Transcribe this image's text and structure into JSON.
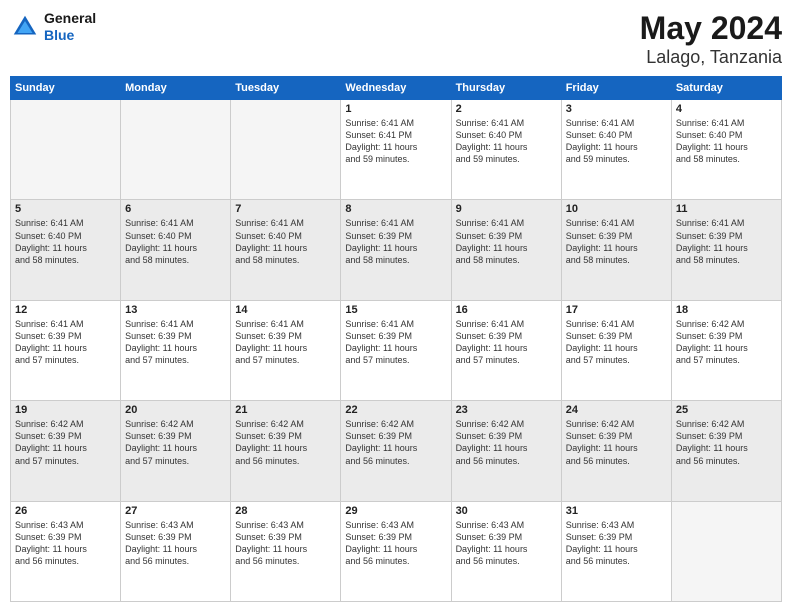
{
  "header": {
    "logo_general": "General",
    "logo_blue": "Blue",
    "month_year": "May 2024",
    "location": "Lalago, Tanzania"
  },
  "weekdays": [
    "Sunday",
    "Monday",
    "Tuesday",
    "Wednesday",
    "Thursday",
    "Friday",
    "Saturday"
  ],
  "weeks": [
    [
      {
        "day": "",
        "info": ""
      },
      {
        "day": "",
        "info": ""
      },
      {
        "day": "",
        "info": ""
      },
      {
        "day": "1",
        "info": "Sunrise: 6:41 AM\nSunset: 6:41 PM\nDaylight: 11 hours\nand 59 minutes."
      },
      {
        "day": "2",
        "info": "Sunrise: 6:41 AM\nSunset: 6:40 PM\nDaylight: 11 hours\nand 59 minutes."
      },
      {
        "day": "3",
        "info": "Sunrise: 6:41 AM\nSunset: 6:40 PM\nDaylight: 11 hours\nand 59 minutes."
      },
      {
        "day": "4",
        "info": "Sunrise: 6:41 AM\nSunset: 6:40 PM\nDaylight: 11 hours\nand 58 minutes."
      }
    ],
    [
      {
        "day": "5",
        "info": "Sunrise: 6:41 AM\nSunset: 6:40 PM\nDaylight: 11 hours\nand 58 minutes."
      },
      {
        "day": "6",
        "info": "Sunrise: 6:41 AM\nSunset: 6:40 PM\nDaylight: 11 hours\nand 58 minutes."
      },
      {
        "day": "7",
        "info": "Sunrise: 6:41 AM\nSunset: 6:40 PM\nDaylight: 11 hours\nand 58 minutes."
      },
      {
        "day": "8",
        "info": "Sunrise: 6:41 AM\nSunset: 6:39 PM\nDaylight: 11 hours\nand 58 minutes."
      },
      {
        "day": "9",
        "info": "Sunrise: 6:41 AM\nSunset: 6:39 PM\nDaylight: 11 hours\nand 58 minutes."
      },
      {
        "day": "10",
        "info": "Sunrise: 6:41 AM\nSunset: 6:39 PM\nDaylight: 11 hours\nand 58 minutes."
      },
      {
        "day": "11",
        "info": "Sunrise: 6:41 AM\nSunset: 6:39 PM\nDaylight: 11 hours\nand 58 minutes."
      }
    ],
    [
      {
        "day": "12",
        "info": "Sunrise: 6:41 AM\nSunset: 6:39 PM\nDaylight: 11 hours\nand 57 minutes."
      },
      {
        "day": "13",
        "info": "Sunrise: 6:41 AM\nSunset: 6:39 PM\nDaylight: 11 hours\nand 57 minutes."
      },
      {
        "day": "14",
        "info": "Sunrise: 6:41 AM\nSunset: 6:39 PM\nDaylight: 11 hours\nand 57 minutes."
      },
      {
        "day": "15",
        "info": "Sunrise: 6:41 AM\nSunset: 6:39 PM\nDaylight: 11 hours\nand 57 minutes."
      },
      {
        "day": "16",
        "info": "Sunrise: 6:41 AM\nSunset: 6:39 PM\nDaylight: 11 hours\nand 57 minutes."
      },
      {
        "day": "17",
        "info": "Sunrise: 6:41 AM\nSunset: 6:39 PM\nDaylight: 11 hours\nand 57 minutes."
      },
      {
        "day": "18",
        "info": "Sunrise: 6:42 AM\nSunset: 6:39 PM\nDaylight: 11 hours\nand 57 minutes."
      }
    ],
    [
      {
        "day": "19",
        "info": "Sunrise: 6:42 AM\nSunset: 6:39 PM\nDaylight: 11 hours\nand 57 minutes."
      },
      {
        "day": "20",
        "info": "Sunrise: 6:42 AM\nSunset: 6:39 PM\nDaylight: 11 hours\nand 57 minutes."
      },
      {
        "day": "21",
        "info": "Sunrise: 6:42 AM\nSunset: 6:39 PM\nDaylight: 11 hours\nand 56 minutes."
      },
      {
        "day": "22",
        "info": "Sunrise: 6:42 AM\nSunset: 6:39 PM\nDaylight: 11 hours\nand 56 minutes."
      },
      {
        "day": "23",
        "info": "Sunrise: 6:42 AM\nSunset: 6:39 PM\nDaylight: 11 hours\nand 56 minutes."
      },
      {
        "day": "24",
        "info": "Sunrise: 6:42 AM\nSunset: 6:39 PM\nDaylight: 11 hours\nand 56 minutes."
      },
      {
        "day": "25",
        "info": "Sunrise: 6:42 AM\nSunset: 6:39 PM\nDaylight: 11 hours\nand 56 minutes."
      }
    ],
    [
      {
        "day": "26",
        "info": "Sunrise: 6:43 AM\nSunset: 6:39 PM\nDaylight: 11 hours\nand 56 minutes."
      },
      {
        "day": "27",
        "info": "Sunrise: 6:43 AM\nSunset: 6:39 PM\nDaylight: 11 hours\nand 56 minutes."
      },
      {
        "day": "28",
        "info": "Sunrise: 6:43 AM\nSunset: 6:39 PM\nDaylight: 11 hours\nand 56 minutes."
      },
      {
        "day": "29",
        "info": "Sunrise: 6:43 AM\nSunset: 6:39 PM\nDaylight: 11 hours\nand 56 minutes."
      },
      {
        "day": "30",
        "info": "Sunrise: 6:43 AM\nSunset: 6:39 PM\nDaylight: 11 hours\nand 56 minutes."
      },
      {
        "day": "31",
        "info": "Sunrise: 6:43 AM\nSunset: 6:39 PM\nDaylight: 11 hours\nand 56 minutes."
      },
      {
        "day": "",
        "info": ""
      }
    ]
  ]
}
